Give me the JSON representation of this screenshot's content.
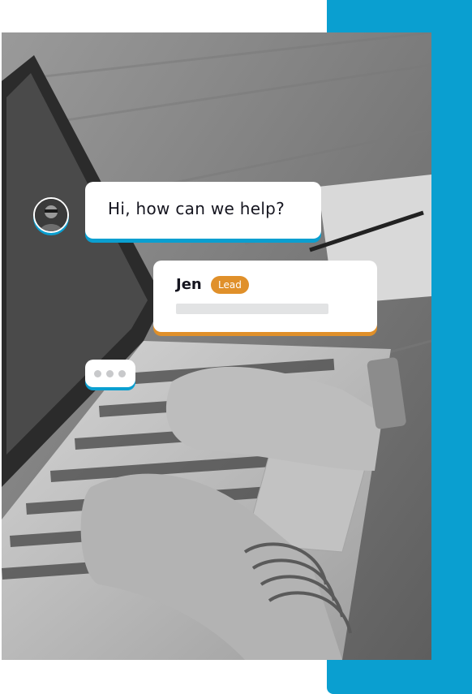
{
  "chat": {
    "question": "Hi, how can we help?",
    "reply_name": "Jen",
    "reply_badge": "Lead"
  },
  "colors": {
    "accent_blue": "#0a9fd0",
    "accent_orange": "#e0902a"
  },
  "icons": {
    "avatar": "agent-avatar-photo",
    "typing": "typing-dots-icon"
  }
}
